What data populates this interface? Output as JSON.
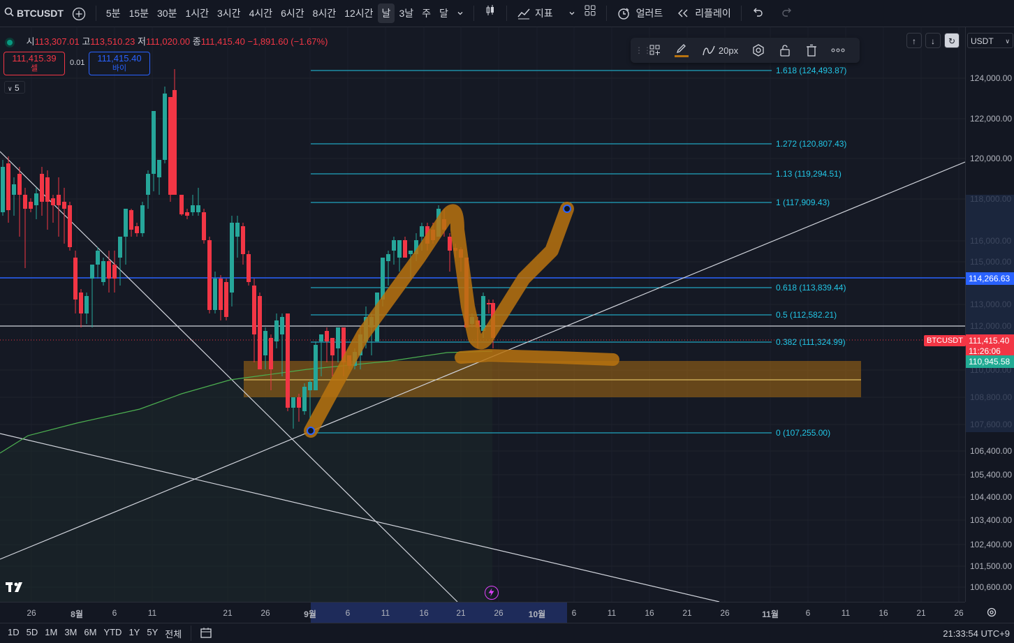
{
  "toolbar": {
    "symbol": "BTCUSDT",
    "intervals": [
      "5분",
      "15분",
      "30분",
      "1시간",
      "3시간",
      "4시간",
      "6시간",
      "8시간",
      "12시간",
      "날",
      "3날",
      "주",
      "달"
    ],
    "active_interval": "날",
    "indicators_label": "지표",
    "alert_label": "얼러트",
    "replay_label": "리플레이"
  },
  "legend": {
    "open_label": "시",
    "open": "113,307.01",
    "high_label": "고",
    "high": "113,510.23",
    "low_label": "저",
    "low": "111,020.00",
    "close_label": "종",
    "close": "111,415.40",
    "change": "−1,891.60 (−1.67%)"
  },
  "trade": {
    "sell_price": "111,415.39",
    "sell_label": "셀",
    "spread": "0.01",
    "buy_price": "111,415.40",
    "buy_label": "바이",
    "indicator_count": "5"
  },
  "drawing_toolbar": {
    "stroke_width": "20px"
  },
  "currency": "USDT",
  "price_axis": {
    "ticks": [
      "124,000.00",
      "122,000.00",
      "120,000.00",
      "118,000.00",
      "116,000.00",
      "115,000.00",
      "113,000.00",
      "112,000.00",
      "110,000.00",
      "108,800.00",
      "107,600.00",
      "106,400.00",
      "105,400.00",
      "104,400.00",
      "103,400.00",
      "102,400.00",
      "101,500.00",
      "100,600.00"
    ],
    "blue_line_price": "114,266.63",
    "symbol_tag": "BTCUSDT",
    "last_price": "111,415.40",
    "countdown": "11:26:06",
    "ma_price": "110,945.58"
  },
  "fib_levels": [
    {
      "label": "1.618 (124,493.87)"
    },
    {
      "label": "1.272 (120,807.43)"
    },
    {
      "label": "1.13 (119,294.51)"
    },
    {
      "label": "1 (117,909.43)"
    },
    {
      "label": "0.618 (113,839.44)"
    },
    {
      "label": "0.5 (112,582.21)"
    },
    {
      "label": "0.382 (111,324.99)"
    },
    {
      "label": "0 (107,255.00)"
    }
  ],
  "time_axis": {
    "ticks": [
      "26",
      "8월",
      "6",
      "11",
      "21",
      "26",
      "9월",
      "6",
      "11",
      "16",
      "21",
      "26",
      "10월",
      "6",
      "11",
      "16",
      "21",
      "26",
      "11월",
      "6",
      "11",
      "16",
      "21",
      "26"
    ]
  },
  "bottom_bar": {
    "ranges": [
      "1D",
      "5D",
      "1M",
      "3M",
      "6M",
      "YTD",
      "1Y",
      "5Y",
      "전체"
    ],
    "clock": "21:33:54 UTC+9"
  },
  "colors": {
    "bull": "#26a69a",
    "bear": "#f23645",
    "fib": "#22c6e6",
    "highlight": "#b8730f",
    "blue_line": "#2962ff",
    "ma": "#4caf50"
  }
}
